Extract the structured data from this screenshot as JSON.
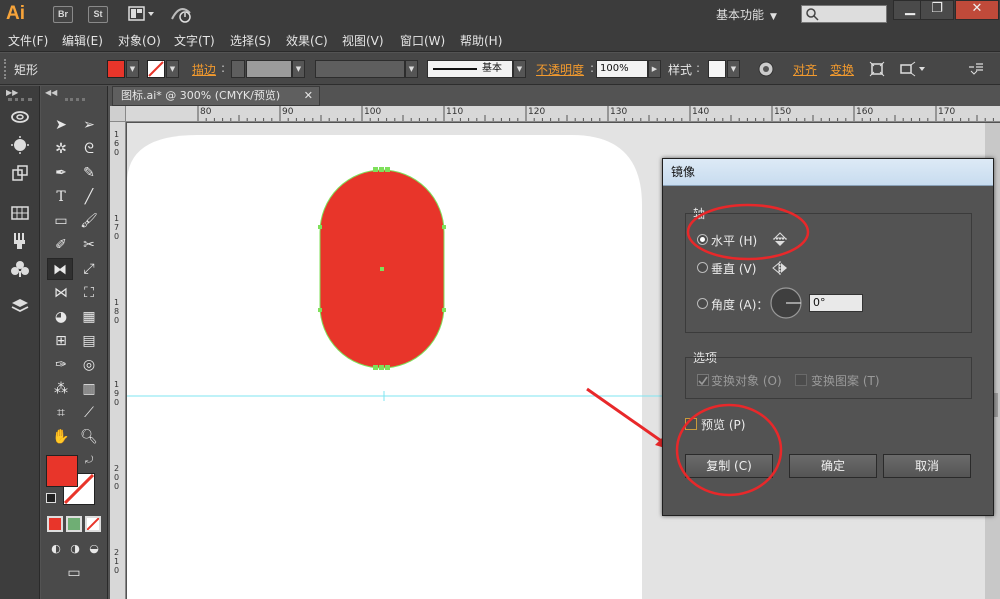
{
  "app": {
    "logo": "Ai",
    "bridge_label": "Br",
    "stock_label": "St",
    "workspace_label": "基本功能"
  },
  "menu": [
    "文件(F)",
    "编辑(E)",
    "对象(O)",
    "文字(T)",
    "选择(S)",
    "效果(C)",
    "视图(V)",
    "窗口(W)",
    "帮助(H)"
  ],
  "control": {
    "selection_type": "矩形",
    "stroke_label": "描边",
    "stroke_style": "基本",
    "opacity_label": "不透明度",
    "opacity_value": "100%",
    "style_label": "样式",
    "align_label": "对齐",
    "transform_label": "变换"
  },
  "document": {
    "tab_title": "图标.ai* @ 300% (CMYK/预览)",
    "ruler_h": [
      "80",
      "90",
      "100",
      "110",
      "120",
      "130",
      "140",
      "150",
      "160",
      "170"
    ],
    "ruler_v": [
      "160",
      "170",
      "180",
      "190",
      "200",
      "210"
    ]
  },
  "dialog": {
    "title": "镜像",
    "axis_label": "轴",
    "horizontal_label": "水平 (H)",
    "vertical_label": "垂直 (V)",
    "angle_label": "角度 (A)：",
    "angle_value": "0°",
    "options_label": "选项",
    "transform_objects": "变换对象 (O)",
    "transform_patterns": "变换图案 (T)",
    "preview_label": "预览 (P)",
    "copy_label": "复制 (C)",
    "ok_label": "确定",
    "cancel_label": "取消"
  },
  "colors": {
    "fill": "#e8352a",
    "annotation": "#e8282a",
    "guide": "#7fe6f2",
    "anchor": "#7ee05a"
  }
}
